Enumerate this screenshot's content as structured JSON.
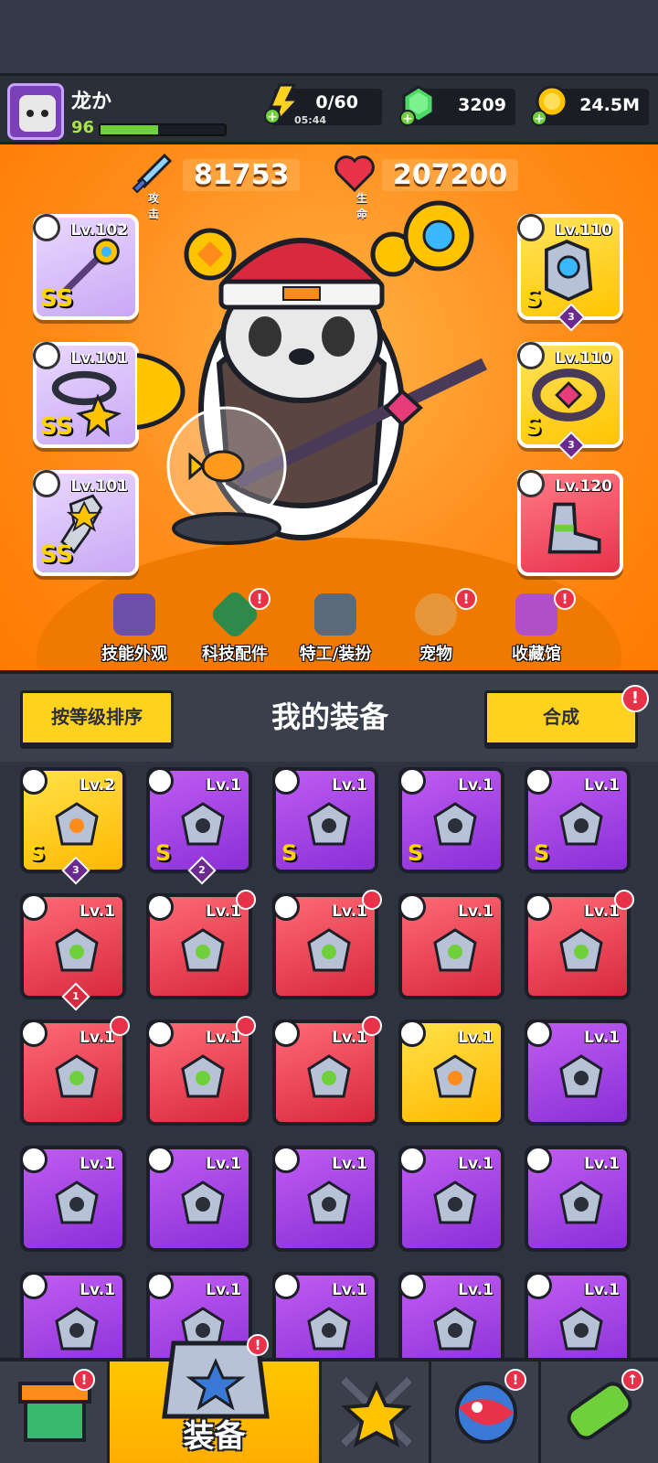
{
  "player": {
    "name": "龙か",
    "level": "96",
    "xp_fraction": 0.46
  },
  "resources": {
    "energy": "0/60",
    "energy_timer": "05:44",
    "gems": "3209",
    "gold": "24.5M"
  },
  "stats": {
    "attack_value": "81753",
    "attack_label": "攻击",
    "hp_value": "207200",
    "hp_label": "生命"
  },
  "equipped": {
    "left": [
      {
        "level": "Lv.102",
        "tag": "SS"
      },
      {
        "level": "Lv.101",
        "tag": "SS"
      },
      {
        "level": "Lv.101",
        "tag": "SS"
      }
    ],
    "right": [
      {
        "level": "Lv.110",
        "tag": "S",
        "stars": "3"
      },
      {
        "level": "Lv.110",
        "tag": "S",
        "stars": "3"
      },
      {
        "level": "Lv.120",
        "tag": ""
      }
    ]
  },
  "hero_menu": [
    {
      "label": "技能外观"
    },
    {
      "label": "科技配件"
    },
    {
      "label": "特工/装扮"
    },
    {
      "label": "宠物"
    },
    {
      "label": "收藏馆"
    }
  ],
  "equipment_section": {
    "sort_button": "按等级排序",
    "title": "我的装备",
    "merge_button": "合成"
  },
  "inventory": [
    {
      "level": "Lv.2",
      "rarity": "yellow",
      "tag": "S",
      "stars": "3"
    },
    {
      "level": "Lv.1",
      "rarity": "purple",
      "tag": "S",
      "stars": "2"
    },
    {
      "level": "Lv.1",
      "rarity": "purple",
      "tag": "S"
    },
    {
      "level": "Lv.1",
      "rarity": "purple",
      "tag": "S"
    },
    {
      "level": "Lv.1",
      "rarity": "purple",
      "tag": "S"
    },
    {
      "level": "Lv.1",
      "rarity": "red",
      "stars": "1"
    },
    {
      "level": "Lv.1",
      "rarity": "red"
    },
    {
      "level": "Lv.1",
      "rarity": "red"
    },
    {
      "level": "Lv.1",
      "rarity": "red"
    },
    {
      "level": "Lv.1",
      "rarity": "red"
    },
    {
      "level": "Lv.1",
      "rarity": "red"
    },
    {
      "level": "Lv.1",
      "rarity": "red"
    },
    {
      "level": "Lv.1",
      "rarity": "red"
    },
    {
      "level": "Lv.1",
      "rarity": "yellow"
    },
    {
      "level": "Lv.1",
      "rarity": "purple"
    },
    {
      "level": "Lv.1",
      "rarity": "purple"
    },
    {
      "level": "Lv.1",
      "rarity": "purple"
    },
    {
      "level": "Lv.1",
      "rarity": "purple"
    },
    {
      "level": "Lv.1",
      "rarity": "purple"
    },
    {
      "level": "Lv.1",
      "rarity": "purple"
    },
    {
      "level": "Lv.1",
      "rarity": "purple"
    },
    {
      "level": "Lv.1",
      "rarity": "purple"
    },
    {
      "level": "Lv.1",
      "rarity": "purple"
    },
    {
      "level": "Lv.1",
      "rarity": "purple"
    },
    {
      "level": "Lv.1",
      "rarity": "purple"
    }
  ],
  "bottom_nav": {
    "equipment_label": "装备"
  },
  "colors": {
    "accent": "#ffd21f",
    "alert": "#e8324a",
    "purple": "#8a2fd6",
    "red": "#d8293f",
    "gold": "#ffb800"
  }
}
